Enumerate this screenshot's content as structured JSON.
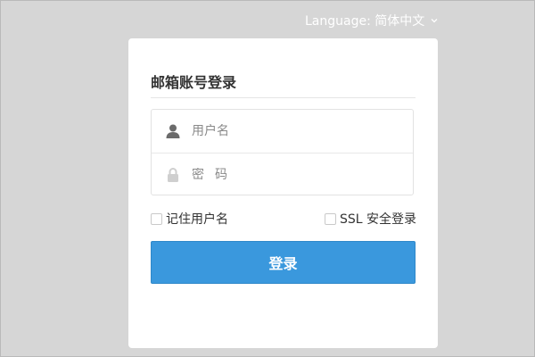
{
  "language": {
    "label": "Language: 简体中文",
    "icon": "chevron-down-icon"
  },
  "login_card": {
    "title": "邮箱账号登录",
    "username": {
      "placeholder": "用户名",
      "value": "",
      "icon": "user-icon"
    },
    "password": {
      "placeholder": "密码",
      "value": "",
      "icon": "lock-icon"
    },
    "remember_label": "记住用户名",
    "ssl_label": "SSL 安全登录",
    "submit_label": "登录"
  },
  "colors": {
    "background": "#d6d6d6",
    "card": "#ffffff",
    "button": "#3a98dd",
    "icon": "#6b6b6b"
  }
}
